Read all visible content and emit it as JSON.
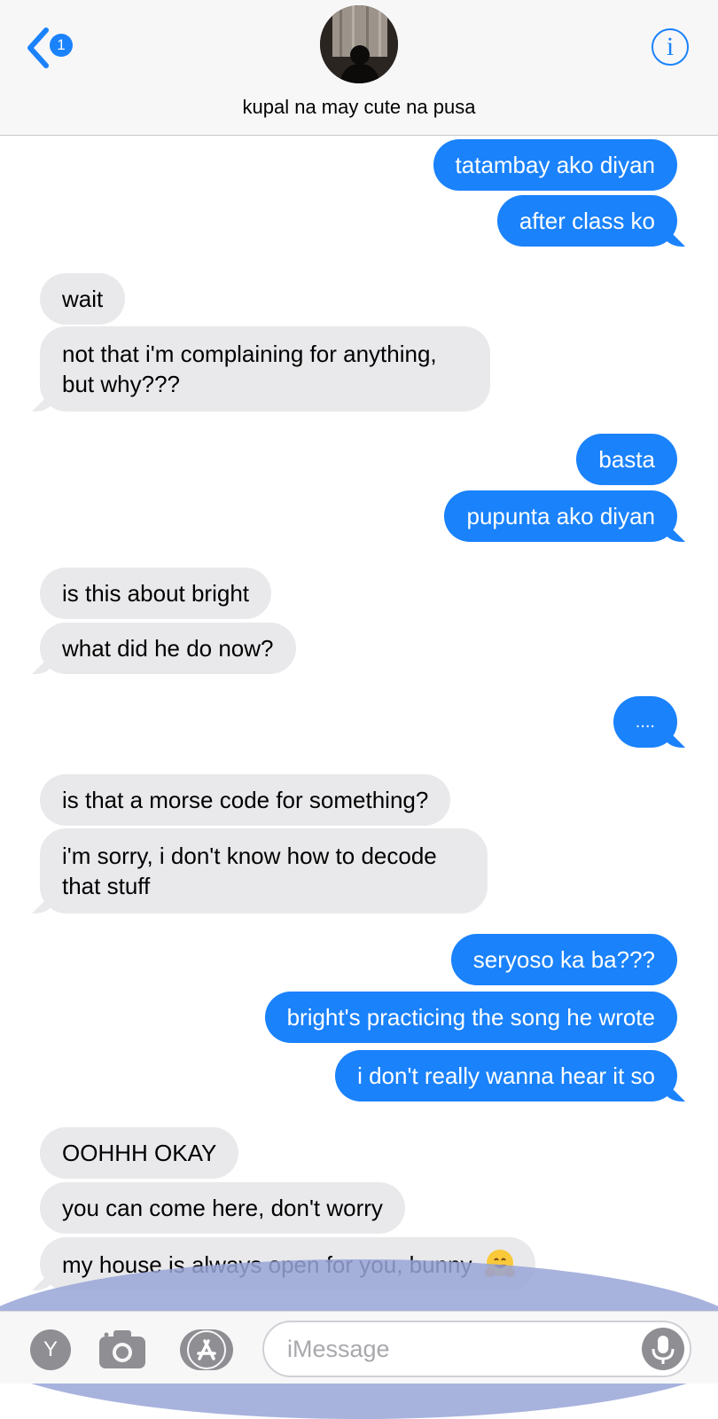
{
  "header": {
    "unread_count": "1",
    "contact_name": "kupal na may cute na pusa",
    "info_label": "i"
  },
  "messages": [
    {
      "sender": "me",
      "text": "tatambay ako diyan"
    },
    {
      "sender": "me",
      "text": "after class ko"
    },
    {
      "sender": "them",
      "text": "wait"
    },
    {
      "sender": "them",
      "text": "not that i'm complaining for anything, but why???"
    },
    {
      "sender": "me",
      "text": "basta"
    },
    {
      "sender": "me",
      "text": "pupunta ako diyan"
    },
    {
      "sender": "them",
      "text": "is this about bright"
    },
    {
      "sender": "them",
      "text": "what did he do now?"
    },
    {
      "sender": "me",
      "text": "...."
    },
    {
      "sender": "them",
      "text": "is that a morse code for something?"
    },
    {
      "sender": "them",
      "text": "i'm sorry, i don't know how to decode that stuff"
    },
    {
      "sender": "me",
      "text": "seryoso ka ba???"
    },
    {
      "sender": "me",
      "text": "bright's practicing the song he wrote"
    },
    {
      "sender": "me",
      "text": "i don't really wanna hear it so"
    },
    {
      "sender": "them",
      "text": "OOHHH OKAY"
    },
    {
      "sender": "them",
      "text": "you can come here, don't worry"
    },
    {
      "sender": "them",
      "text": "my house is always open for you, bunny",
      "emoji": "hugging-face"
    }
  ],
  "input_bar": {
    "app_icon_label": "Y",
    "placeholder": "iMessage"
  },
  "colors": {
    "sent": "#1a82fb",
    "received": "#e9e9eb",
    "accent": "#1a82fb"
  }
}
